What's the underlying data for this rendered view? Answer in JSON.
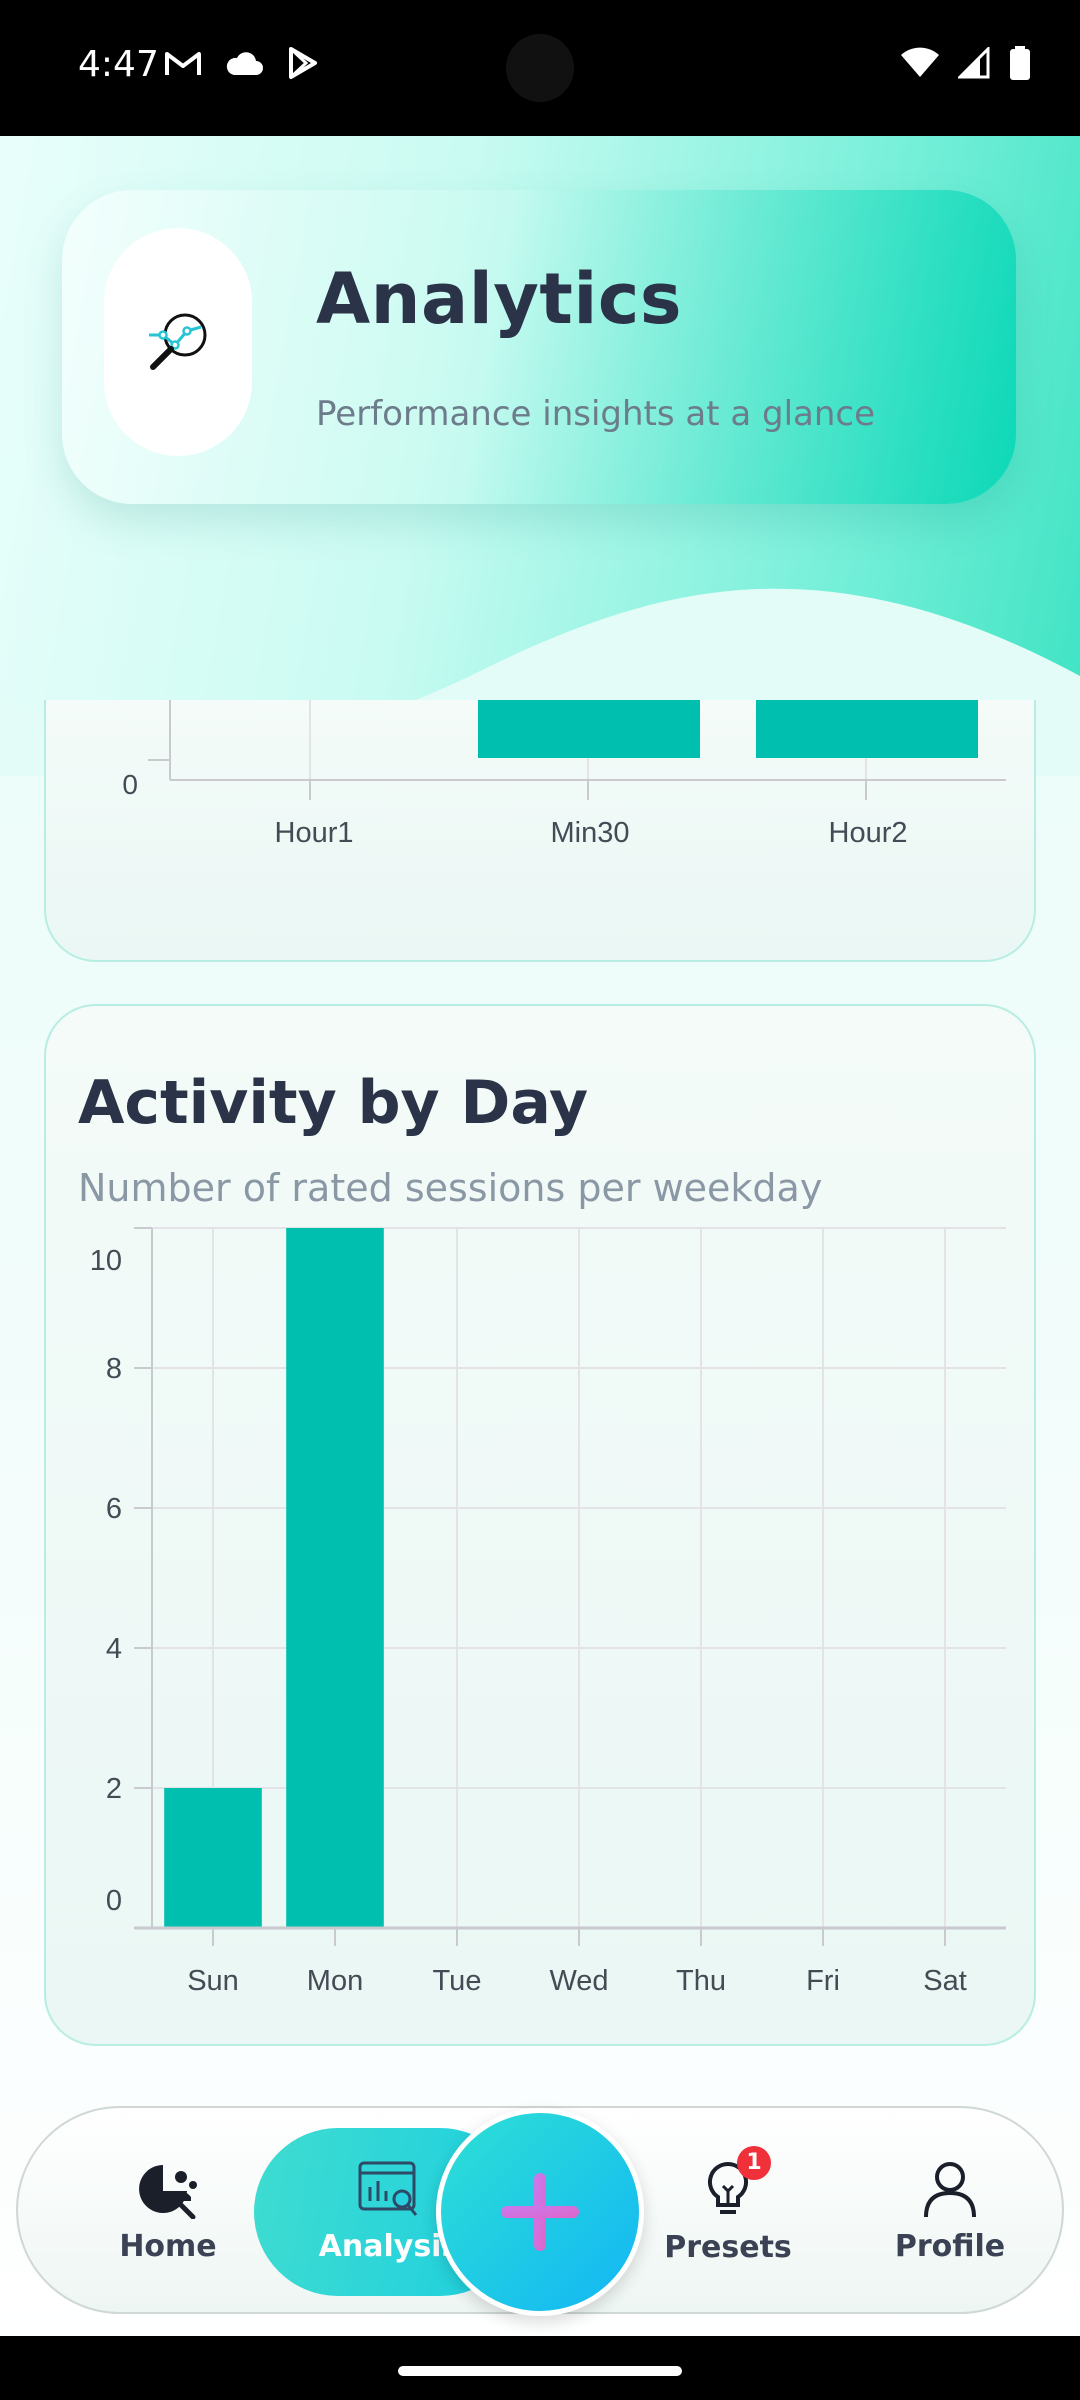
{
  "status_bar": {
    "time": "4:47",
    "left_icons": [
      "gmail-icon",
      "cloud-icon",
      "play-store-icon"
    ],
    "right_icons": [
      "wifi-icon",
      "signal-icon",
      "battery-icon"
    ]
  },
  "header": {
    "title": "Analytics",
    "subtitle": "Performance insights at a glance",
    "icon": "analytics-magnifier-icon"
  },
  "duration_chart": {
    "chart_data": {
      "type": "bar",
      "categories": [
        "Hour1",
        "Min30",
        "Hour2"
      ],
      "y_visible_tick": "0",
      "bars_visible": [
        "Min30",
        "Hour2"
      ]
    }
  },
  "activity_card": {
    "title": "Activity by Day",
    "subtitle": "Number of rated sessions per weekday"
  },
  "chart_data": {
    "type": "bar",
    "categories": [
      "Sun",
      "Mon",
      "Tue",
      "Wed",
      "Thu",
      "Fri",
      "Sat"
    ],
    "values": [
      2,
      10,
      0,
      0,
      0,
      0,
      0
    ],
    "ylim": [
      0,
      10
    ],
    "yticks": [
      0,
      2,
      4,
      6,
      8,
      10
    ],
    "grid": true,
    "color": "#00bfae"
  },
  "nav": {
    "home": "Home",
    "analysis": "Analysis",
    "presets": "Presets",
    "presets_badge": "1",
    "profile": "Profile"
  },
  "colors": {
    "accent": "#00bfae",
    "title": "#2a3348"
  }
}
